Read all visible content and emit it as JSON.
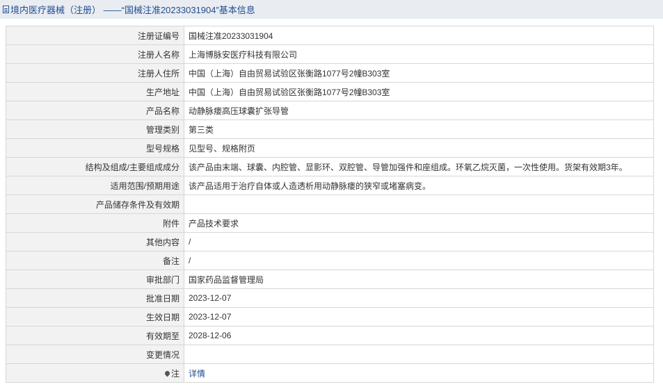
{
  "header": {
    "icon": "document-icon",
    "title": "境内医疗器械（注册） ——“国械注准20233031904”基本信息"
  },
  "rows": [
    {
      "label": "注册证编号",
      "value": "国械注准20233031904"
    },
    {
      "label": "注册人名称",
      "value": "上海博脉安医疗科技有限公司"
    },
    {
      "label": "注册人住所",
      "value": "中国（上海）自由贸易试验区张衡路1077号2幢B303室"
    },
    {
      "label": "生产地址",
      "value": "中国（上海）自由贸易试验区张衡路1077号2幢B303室"
    },
    {
      "label": "产品名称",
      "value": "动静脉瘘高压球囊扩张导管"
    },
    {
      "label": "管理类别",
      "value": "第三类"
    },
    {
      "label": "型号规格",
      "value": "见型号、规格附页"
    },
    {
      "label": "结构及组成/主要组成成分",
      "value": "该产品由末端、球囊、内腔管、显影环、双腔管、导管加强件和座组成。环氧乙烷灭菌，一次性使用。货架有效期3年。"
    },
    {
      "label": "适用范围/预期用途",
      "value": "该产品适用于治疗自体或人造透析用动静脉瘘的狭窄或堵塞病变。"
    },
    {
      "label": "产品储存条件及有效期",
      "value": ""
    },
    {
      "label": "附件",
      "value": "产品技术要求"
    },
    {
      "label": "其他内容",
      "value": "/"
    },
    {
      "label": "备注",
      "value": "/"
    },
    {
      "label": "审批部门",
      "value": "国家药品监督管理局"
    },
    {
      "label": "批准日期",
      "value": "2023-12-07"
    },
    {
      "label": "生效日期",
      "value": "2023-12-07"
    },
    {
      "label": "有效期至",
      "value": "2028-12-06"
    },
    {
      "label": "变更情况",
      "value": ""
    }
  ],
  "note_row": {
    "label": "注",
    "icon": "pin-icon",
    "link": "详情"
  },
  "colors": {
    "header_bg": "#e9ecf1",
    "header_text": "#1f4d91",
    "label_bg": "#f2f2f2",
    "border": "#d6d6d6",
    "link": "#1f4d91"
  }
}
